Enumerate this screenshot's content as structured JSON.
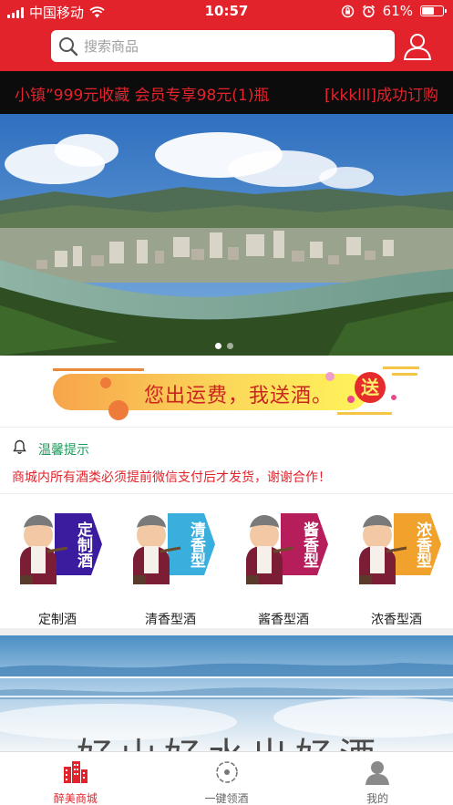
{
  "status_bar": {
    "carrier": "中国移动",
    "time": "10:57",
    "battery": "61%",
    "battery_level": 0.61
  },
  "header": {
    "search_placeholder": "搜索商品",
    "user_icon": "user-icon"
  },
  "ticker": {
    "items": [
      "小镇”999元收藏 会员专享98元(1)瓶",
      "[kkklll]成功订购"
    ]
  },
  "banner": {
    "slide_count": 2,
    "active_slide": 1
  },
  "promo": {
    "text": "您出运费，我送酒。",
    "badge": "送"
  },
  "notice": {
    "title": "温馨提示",
    "text": "商城内所有酒类必须提前微信支付后才发货，谢谢合作！"
  },
  "categories": [
    {
      "label": "定制酒",
      "badge": "定制酒",
      "color": "#3b1c9e"
    },
    {
      "label": "清香型酒",
      "badge": "清香型",
      "color": "#3aaedc"
    },
    {
      "label": "酱香型酒",
      "badge": "酱香型",
      "color": "#b51e5a"
    },
    {
      "label": "浓香型酒",
      "badge": "浓香型",
      "color": "#f0a22c"
    }
  ],
  "lower_banner": {
    "text": "好山好水出好酒"
  },
  "bottom_nav": [
    {
      "label": "醉美商城",
      "icon": "city-icon",
      "active": true
    },
    {
      "label": "一键领酒",
      "icon": "target-icon",
      "active": false
    },
    {
      "label": "我的",
      "icon": "person-icon",
      "active": false
    }
  ],
  "colors": {
    "brand": "#e3232c",
    "notice_title": "#1a9c5a"
  }
}
